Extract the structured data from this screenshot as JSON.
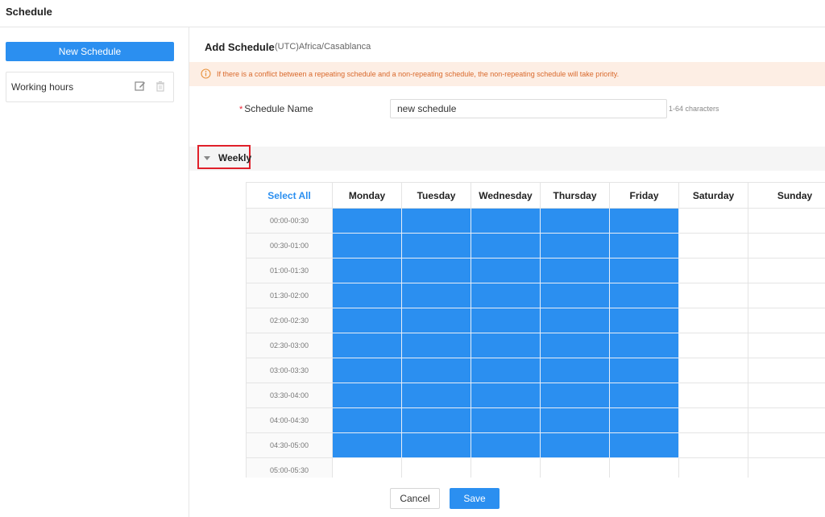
{
  "header": {
    "title": "Schedule"
  },
  "sidebar": {
    "new_button": "New Schedule",
    "items": [
      {
        "label": "Working hours"
      }
    ]
  },
  "form": {
    "title": "Add Schedule",
    "timezone": "(UTC)Africa/Casablanca",
    "notice": "If there is a conflict between a repeating schedule and a non-repeating schedule, the non-repeating schedule will take priority.",
    "name_label": "Schedule Name",
    "name_required_mark": "*",
    "name_value": "new schedule",
    "name_hint": "1-64 characters"
  },
  "weekly": {
    "label": "Weekly",
    "select_all": "Select All",
    "days": [
      "Monday",
      "Tuesday",
      "Wednesday",
      "Thursday",
      "Friday",
      "Saturday",
      "Sunday"
    ],
    "time_slots": [
      "00:00-00:30",
      "00:30-01:00",
      "01:00-01:30",
      "01:30-02:00",
      "02:00-02:30",
      "02:30-03:00",
      "03:00-03:30",
      "03:30-04:00",
      "04:00-04:30",
      "04:30-05:00",
      "05:00-05:30"
    ],
    "selected": [
      [
        true,
        true,
        true,
        true,
        true,
        false,
        false
      ],
      [
        true,
        true,
        true,
        true,
        true,
        false,
        false
      ],
      [
        true,
        true,
        true,
        true,
        true,
        false,
        false
      ],
      [
        true,
        true,
        true,
        true,
        true,
        false,
        false
      ],
      [
        true,
        true,
        true,
        true,
        true,
        false,
        false
      ],
      [
        true,
        true,
        true,
        true,
        true,
        false,
        false
      ],
      [
        true,
        true,
        true,
        true,
        true,
        false,
        false
      ],
      [
        true,
        true,
        true,
        true,
        true,
        false,
        false
      ],
      [
        true,
        true,
        true,
        true,
        true,
        false,
        false
      ],
      [
        true,
        true,
        true,
        true,
        true,
        false,
        false
      ],
      [
        false,
        false,
        false,
        false,
        false,
        false,
        false
      ]
    ]
  },
  "footer": {
    "cancel": "Cancel",
    "save": "Save"
  },
  "colors": {
    "accent": "#2b8ff0",
    "notice_bg": "#fdeee4",
    "notice_text": "#d9692c",
    "highlight_border": "#e0202a"
  }
}
